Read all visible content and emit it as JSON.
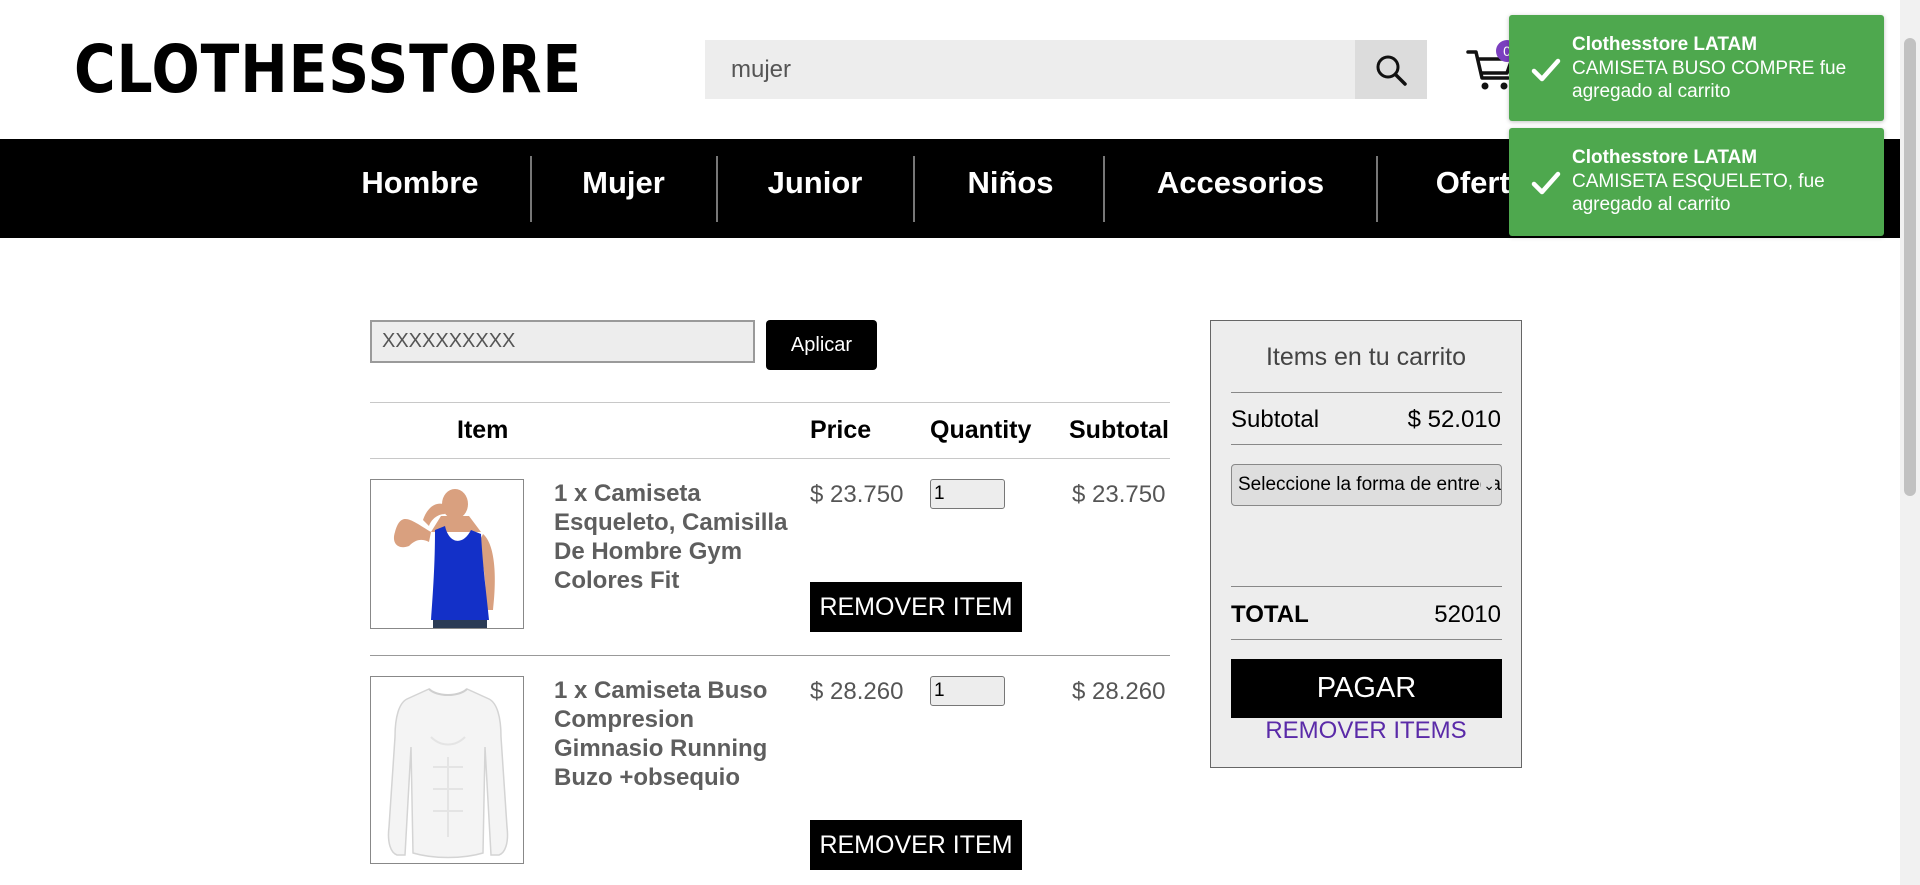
{
  "header": {
    "logo": "CLOTHESSTORE",
    "search_value": "mujer",
    "cart_count": "0"
  },
  "nav": {
    "items": [
      "Hombre",
      "Mujer",
      "Junior",
      "Niños",
      "Accesorios",
      "Ofertas"
    ]
  },
  "coupon": {
    "value": "XXXXXXXXXX",
    "apply_label": "Aplicar"
  },
  "cart_table": {
    "headers": {
      "item": "Item",
      "price": "Price",
      "quantity": "Quantity",
      "subtotal": "Subtotal"
    },
    "rows": [
      {
        "name": "1 x Camiseta Esqueleto, Camisilla De Hombre Gym Colores Fit",
        "price": "$ 23.750",
        "quantity": "1",
        "subtotal": "$ 23.750",
        "remove_label": "REMOVER ITEM"
      },
      {
        "name": "1 x Camiseta Buso Compresion Gimnasio Running Buzo +obsequio",
        "price": "$ 28.260",
        "quantity": "1",
        "subtotal": "$ 28.260",
        "remove_label": "REMOVER ITEM"
      }
    ]
  },
  "summary": {
    "title": "Items en tu carrito",
    "subtotal_label": "Subtotal",
    "subtotal_value": "$ 52.010",
    "delivery_placeholder": "Seleccione la forma de entrega",
    "total_label": "TOTAL",
    "total_value": "52010",
    "pay_label": "PAGAR",
    "remove_all_label": "REMOVER ITEMS"
  },
  "toasts": [
    {
      "title": "Clothesstore LATAM",
      "message": "CAMISETA BUSO COMPRE fue agregado al carrito"
    },
    {
      "title": "Clothesstore LATAM",
      "message": "CAMISETA ESQUELETO, fue agregado al carrito"
    }
  ],
  "colors": {
    "nav_bg": "#000000",
    "toast_bg": "#4ea84e",
    "link_purple": "#5a2aa8",
    "badge_purple": "#7b3fbf",
    "panel_bg": "#ededed"
  }
}
